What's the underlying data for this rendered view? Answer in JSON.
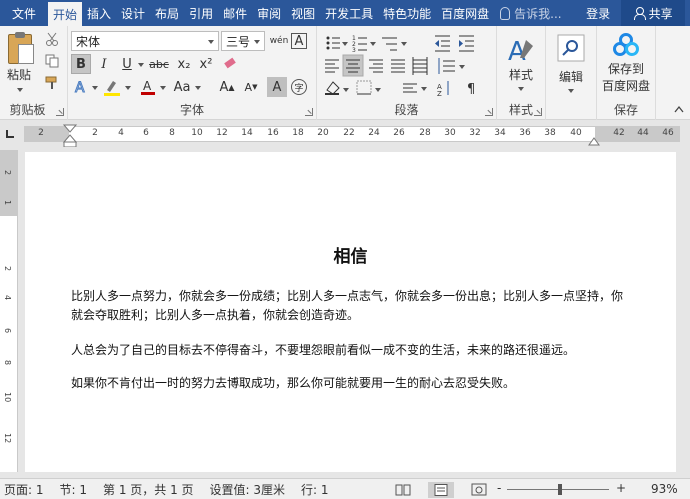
{
  "tabs": [
    "文件",
    "开始",
    "插入",
    "设计",
    "布局",
    "引用",
    "邮件",
    "审阅",
    "视图",
    "开发工具",
    "特色功能",
    "百度网盘"
  ],
  "tell_me": "告诉我...",
  "login": "登录",
  "share": "共享",
  "clipboard": {
    "paste": "粘贴",
    "label": "剪贴板"
  },
  "font": {
    "name": "宋体",
    "size": "三号",
    "label": "字体",
    "bold": "B",
    "italic": "I",
    "underline": "U",
    "strike": "abc",
    "sub": "x₂",
    "sup": "x²",
    "grow": "A",
    "shrink": "A",
    "wen": "wén"
  },
  "paragraph": {
    "label": "段落"
  },
  "styles": {
    "btn": "样式",
    "label": "样式"
  },
  "editing": {
    "btn": "编辑"
  },
  "save": {
    "btn1": "保存到",
    "btn2": "百度网盘",
    "label": "保存"
  },
  "ruler": {
    "ticks": [
      "2",
      "2",
      "4",
      "6",
      "8",
      "10",
      "12",
      "14",
      "16",
      "18",
      "20",
      "22",
      "24",
      "26",
      "28",
      "30",
      "32",
      "34",
      "36",
      "38",
      "40",
      "42",
      "44",
      "46"
    ]
  },
  "vruler": {
    "ticks": [
      "2",
      "1",
      "2",
      "4",
      "6",
      "8",
      "10",
      "12"
    ]
  },
  "document": {
    "title": "相信",
    "paragraphs": [
      "比别人多一点努力，你就会多一份成绩；比别人多一点志气，你就会多一份出息；比别人多一点坚持，你就会夺取胜利；比别人多一点执着，你就会创造奇迹。",
      "人总会为了自己的目标去不停得奋斗，不要埋怨眼前看似一成不变的生活，未来的路还很遥远。",
      "如果你不肯付出一时的努力去博取成功，那么你可能就要用一生的耐心去忍受失败。"
    ]
  },
  "status": {
    "page": "页面: 1",
    "section": "节: 1",
    "pages": "第 1 页，共 1 页",
    "setting": "设置值: 3厘米",
    "line": "行: 1",
    "zoom": "93%",
    "zoom_minus": "-",
    "zoom_plus": "+"
  }
}
